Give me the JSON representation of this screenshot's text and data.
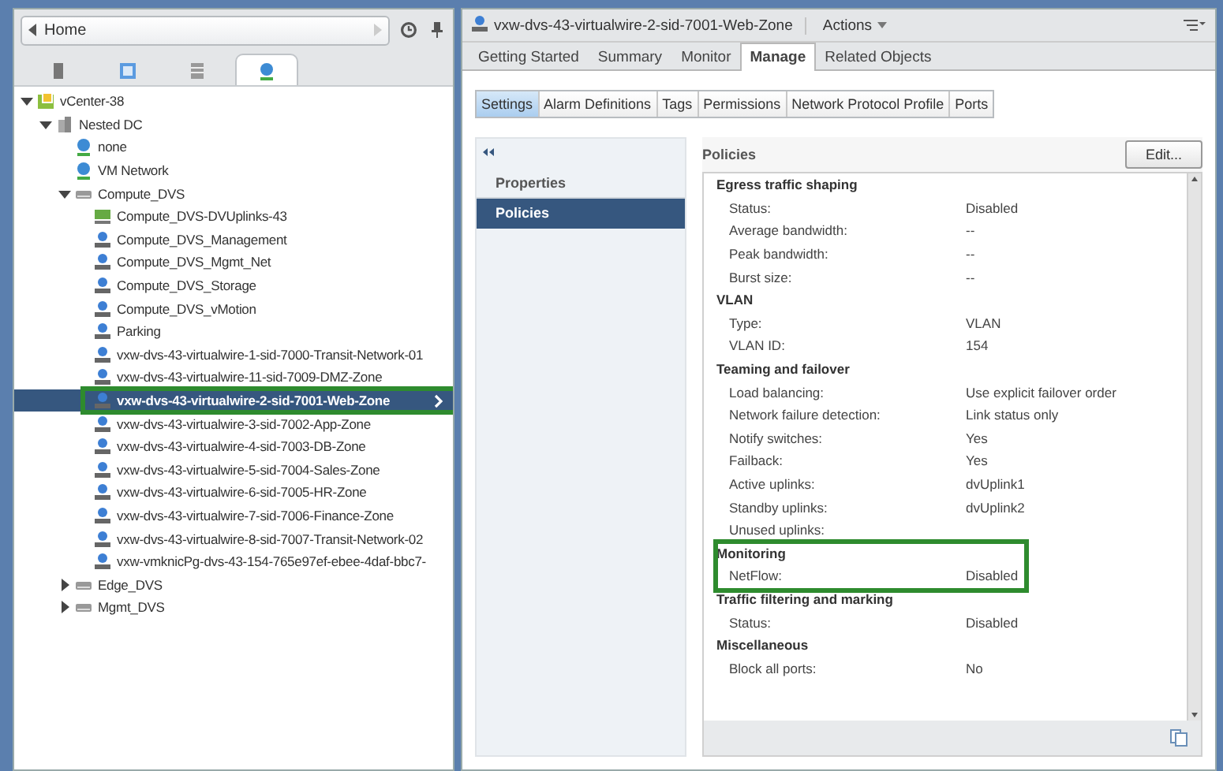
{
  "nav": {
    "title": "Home"
  },
  "nav_tabs": [
    {
      "kind": "hosts",
      "selected": false
    },
    {
      "kind": "vms",
      "selected": false
    },
    {
      "kind": "storage",
      "selected": false
    },
    {
      "kind": "network",
      "selected": true
    }
  ],
  "tree": [
    {
      "label": "vCenter-38",
      "kind": "vcenter",
      "expanded": true,
      "selected": false,
      "children": [
        {
          "label": "Nested DC",
          "kind": "datacenter",
          "expanded": true,
          "selected": false,
          "children": [
            {
              "label": "none",
              "kind": "network",
              "selected": false
            },
            {
              "label": "VM Network",
              "kind": "network",
              "selected": false
            },
            {
              "label": "Compute_DVS",
              "kind": "switch",
              "expanded": true,
              "selected": false,
              "children": [
                {
                  "label": "Compute_DVS-DVUplinks-43",
                  "kind": "uplinks",
                  "selected": false
                },
                {
                  "label": "Compute_DVS_Management",
                  "kind": "portgroup",
                  "selected": false
                },
                {
                  "label": "Compute_DVS_Mgmt_Net",
                  "kind": "portgroup",
                  "selected": false
                },
                {
                  "label": "Compute_DVS_Storage",
                  "kind": "portgroup",
                  "selected": false
                },
                {
                  "label": "Compute_DVS_vMotion",
                  "kind": "portgroup",
                  "selected": false
                },
                {
                  "label": "Parking",
                  "kind": "portgroup",
                  "selected": false
                },
                {
                  "label": "vxw-dvs-43-virtualwire-1-sid-7000-Transit-Network-01",
                  "kind": "portgroup",
                  "selected": false
                },
                {
                  "label": "vxw-dvs-43-virtualwire-11-sid-7009-DMZ-Zone",
                  "kind": "portgroup",
                  "selected": false
                },
                {
                  "label": "vxw-dvs-43-virtualwire-2-sid-7001-Web-Zone",
                  "kind": "portgroup",
                  "selected": true,
                  "highlighted": true
                },
                {
                  "label": "vxw-dvs-43-virtualwire-3-sid-7002-App-Zone",
                  "kind": "portgroup",
                  "selected": false
                },
                {
                  "label": "vxw-dvs-43-virtualwire-4-sid-7003-DB-Zone",
                  "kind": "portgroup",
                  "selected": false
                },
                {
                  "label": "vxw-dvs-43-virtualwire-5-sid-7004-Sales-Zone",
                  "kind": "portgroup",
                  "selected": false
                },
                {
                  "label": "vxw-dvs-43-virtualwire-6-sid-7005-HR-Zone",
                  "kind": "portgroup",
                  "selected": false
                },
                {
                  "label": "vxw-dvs-43-virtualwire-7-sid-7006-Finance-Zone",
                  "kind": "portgroup",
                  "selected": false
                },
                {
                  "label": "vxw-dvs-43-virtualwire-8-sid-7007-Transit-Network-02",
                  "kind": "portgroup",
                  "selected": false
                },
                {
                  "label": "vxw-vmknicPg-dvs-43-154-765e97ef-ebee-4daf-bbc7-",
                  "kind": "portgroup",
                  "selected": false
                }
              ]
            },
            {
              "label": "Edge_DVS",
              "kind": "switch",
              "expanded": false,
              "selected": false
            },
            {
              "label": "Mgmt_DVS",
              "kind": "switch",
              "expanded": false,
              "selected": false
            }
          ]
        }
      ]
    }
  ],
  "object": {
    "title": "vxw-dvs-43-virtualwire-2-sid-7001-Web-Zone",
    "actions": "Actions"
  },
  "tabs": [
    {
      "label": "Getting Started",
      "selected": false
    },
    {
      "label": "Summary",
      "selected": false
    },
    {
      "label": "Monitor",
      "selected": false
    },
    {
      "label": "Manage",
      "selected": true
    },
    {
      "label": "Related Objects",
      "selected": false
    }
  ],
  "subtabs": [
    {
      "label": "Settings",
      "selected": true
    },
    {
      "label": "Alarm Definitions",
      "selected": false
    },
    {
      "label": "Tags",
      "selected": false
    },
    {
      "label": "Permissions",
      "selected": false
    },
    {
      "label": "Network Protocol Profile",
      "selected": false
    },
    {
      "label": "Ports",
      "selected": false
    }
  ],
  "settings_nav": [
    {
      "label": "Properties",
      "selected": false
    },
    {
      "label": "Policies",
      "selected": true
    }
  ],
  "policies": {
    "title": "Policies",
    "edit": "Edit...",
    "sections": [
      {
        "title": "Egress traffic shaping",
        "highlighted": false,
        "rows": [
          {
            "label": "Status:",
            "value": "Disabled"
          },
          {
            "label": "Average bandwidth:",
            "value": "--"
          },
          {
            "label": "Peak bandwidth:",
            "value": "--"
          },
          {
            "label": "Burst size:",
            "value": "--"
          }
        ]
      },
      {
        "title": "VLAN",
        "highlighted": false,
        "rows": [
          {
            "label": "Type:",
            "value": "VLAN"
          },
          {
            "label": "VLAN ID:",
            "value": "154"
          }
        ]
      },
      {
        "title": "Teaming and failover",
        "highlighted": false,
        "rows": [
          {
            "label": "Load balancing:",
            "value": "Use explicit failover order"
          },
          {
            "label": "Network failure detection:",
            "value": "Link status only"
          },
          {
            "label": "Notify switches:",
            "value": "Yes"
          },
          {
            "label": "Failback:",
            "value": "Yes"
          },
          {
            "label": "Active uplinks:",
            "value": "dvUplink1"
          },
          {
            "label": "Standby uplinks:",
            "value": "dvUplink2"
          },
          {
            "label": "Unused uplinks:"
          }
        ]
      },
      {
        "title": "Monitoring",
        "highlighted": true,
        "rows": [
          {
            "label": "NetFlow:",
            "value": "Disabled"
          }
        ]
      },
      {
        "title": "Traffic filtering and marking",
        "highlighted": false,
        "rows": [
          {
            "label": "Status:",
            "value": "Disabled"
          }
        ]
      },
      {
        "title": "Miscellaneous",
        "highlighted": false,
        "rows": [
          {
            "label": "Block all ports:",
            "value": "No"
          }
        ]
      }
    ]
  }
}
